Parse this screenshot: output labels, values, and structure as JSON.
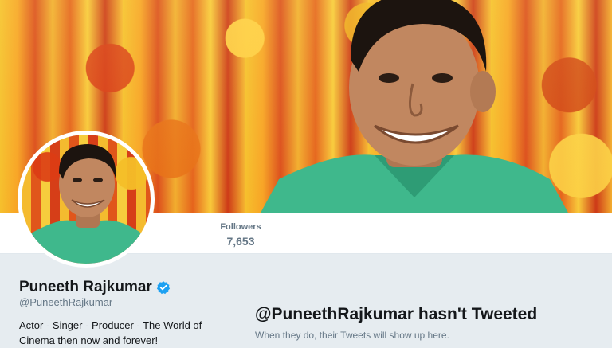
{
  "header": {
    "banner_alt": "Header photo",
    "colors": {
      "banner_warm": "#f2a825",
      "shirt": "#3fb88c"
    }
  },
  "nav": {
    "stats": [
      {
        "label": "Followers",
        "value": "7,653"
      }
    ]
  },
  "profile": {
    "name": "Puneeth Rajkumar",
    "handle": "@PuneethRajkumar",
    "verified_icon": "verified-badge-icon",
    "bio": "Actor - Singer - Producer - The World of Cinema then now and forever!",
    "accent": "#1da1f2"
  },
  "timeline": {
    "empty_handle": "@PuneethRajkumar",
    "empty_suffix": "hasn't Tweeted",
    "empty_subtitle": "When they do, their Tweets will show up here."
  }
}
